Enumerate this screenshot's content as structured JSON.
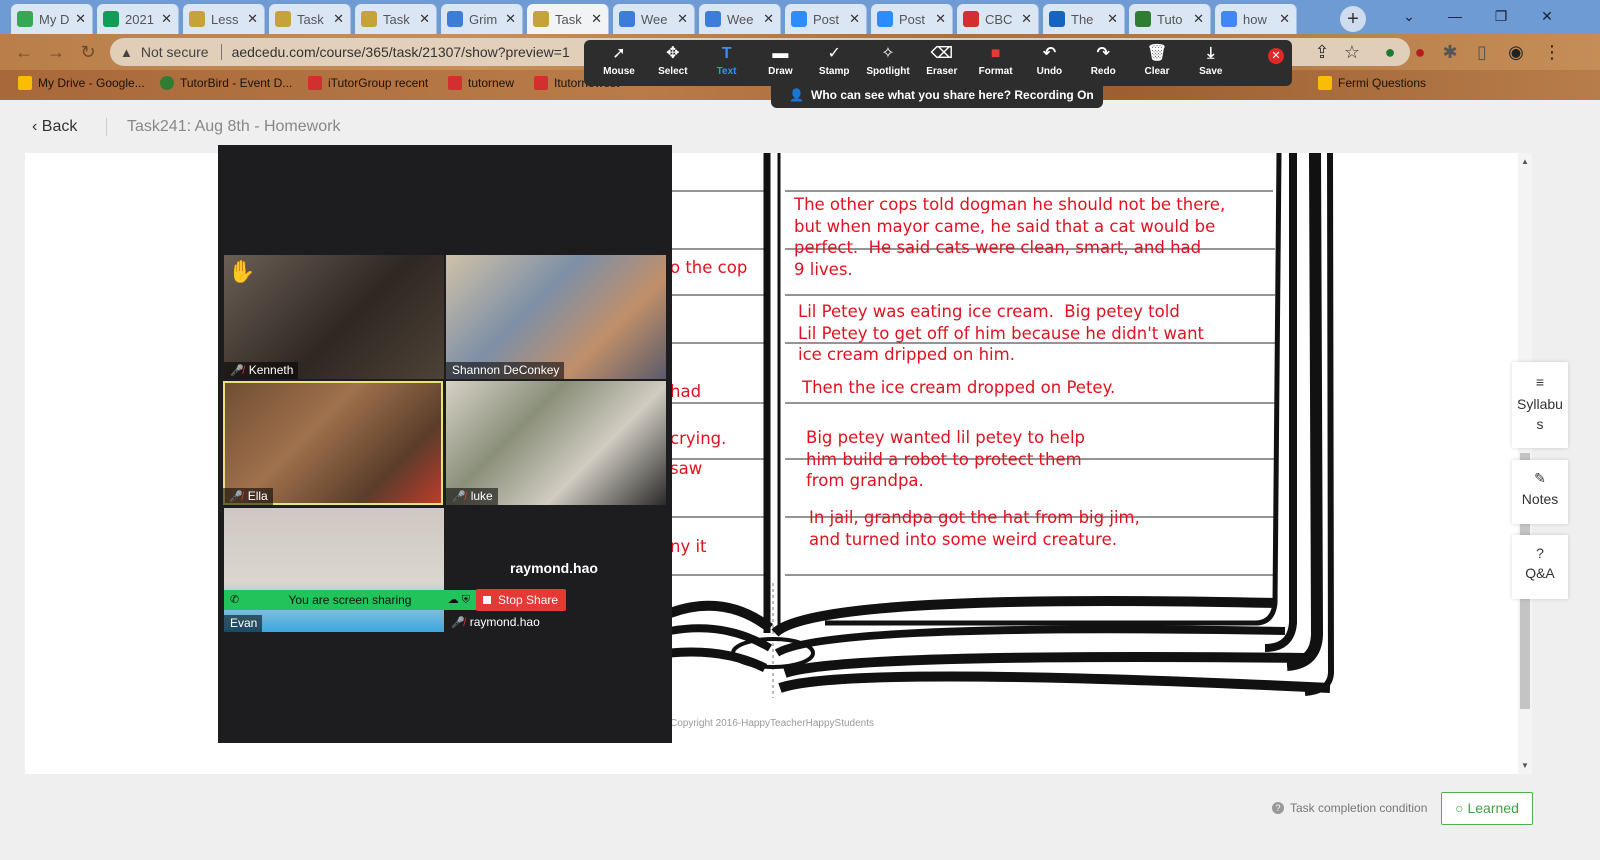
{
  "browser": {
    "tabs": [
      {
        "title": "My D",
        "color": "#34a853",
        "active": false
      },
      {
        "title": "2021",
        "color": "#0f9d58",
        "active": false
      },
      {
        "title": "Less",
        "color": "#c5a23a",
        "active": false
      },
      {
        "title": "Task",
        "color": "#c5a23a",
        "active": false
      },
      {
        "title": "Task",
        "color": "#c5a23a",
        "active": false
      },
      {
        "title": "Grim",
        "color": "#3b7dd8",
        "active": false
      },
      {
        "title": "Task",
        "color": "#c5a23a",
        "active": true
      },
      {
        "title": "Wee",
        "color": "#3b7dd8",
        "active": false
      },
      {
        "title": "Wee",
        "color": "#3b7dd8",
        "active": false
      },
      {
        "title": "Post",
        "color": "#2d8cff",
        "active": false
      },
      {
        "title": "Post",
        "color": "#2d8cff",
        "active": false
      },
      {
        "title": "CBC",
        "color": "#d32f2f",
        "active": false
      },
      {
        "title": "The",
        "color": "#1565c0",
        "active": false
      },
      {
        "title": "Tuto",
        "color": "#2e7d32",
        "active": false
      },
      {
        "title": "how",
        "color": "#4285f4",
        "active": false
      }
    ],
    "newtab_label": "+",
    "not_secure": "Not secure",
    "url": "aedcedu.com/course/365/task/21307/show?preview=1",
    "bookmarks": [
      {
        "label": "My Drive - Google...",
        "color": "#fbbc04"
      },
      {
        "label": "TutorBird - Event D...",
        "color": "#2e7d32"
      },
      {
        "label": "iTutorGroup recent",
        "color": "#d32f2f"
      },
      {
        "label": "tutornew",
        "color": "#d32f2f"
      },
      {
        "label": "Itutornewest",
        "color": "#d32f2f"
      },
      {
        "label": "Fermi Questions",
        "color": "#fbbc04"
      }
    ]
  },
  "zoom_toolbar": {
    "tools": [
      {
        "icon": "➚",
        "label": "Mouse"
      },
      {
        "icon": "✥",
        "label": "Select"
      },
      {
        "icon": "T",
        "label": "Text",
        "highlight": true
      },
      {
        "icon": "▬",
        "label": "Draw"
      },
      {
        "icon": "✓",
        "label": "Stamp"
      },
      {
        "icon": "✧",
        "label": "Spotlight"
      },
      {
        "icon": "⌫",
        "label": "Eraser"
      },
      {
        "icon": "■",
        "label": "Format"
      },
      {
        "icon": "↶",
        "label": "Undo"
      },
      {
        "icon": "↷",
        "label": "Redo"
      },
      {
        "icon": "🗑",
        "label": "Clear"
      },
      {
        "icon": "⤓",
        "label": "Save"
      }
    ],
    "banner": "Who can see what you share here? Recording On"
  },
  "page": {
    "back_label": "Back",
    "breadcrumb": "Task241:  Aug 8th - Homework",
    "copyright": "Copyright 2016-HappyTeacherHappyStudents",
    "left_fragments": [
      "o the cop",
      "had",
      "crying.",
      "saw",
      "ny it"
    ],
    "notes": [
      "The other cops told dogman he should not be there,\nbut when mayor came, he said that a cat would be\nperfect.  He said cats were clean, smart, and had\n9 lives.",
      "Lil Petey was eating ice cream.  Big petey told\nLil Petey to get off of him because he didn't want\nice cream dripped on him.",
      "Then the ice cream dropped on Petey.",
      "Big petey wanted lil petey to help\nhim build a robot to protect them\nfrom grandpa.",
      "In jail, grandpa got the hat from big jim,\nand turned into some weird creature."
    ],
    "side_tabs": [
      {
        "icon": "≡",
        "label": "Syllabu\ns"
      },
      {
        "icon": "✎",
        "label": "Notes"
      },
      {
        "icon": "?",
        "label": "Q&A"
      }
    ],
    "completion_label": "Task completion condition",
    "learned_label": "○ Learned"
  },
  "gallery": {
    "participants": [
      {
        "name": "Kenneth",
        "bg": "#4a4038"
      },
      {
        "name": "Shannon DeConkey",
        "bg": "#9c8f7e"
      },
      {
        "name": "Ella",
        "bg": "#7a5a40"
      },
      {
        "name": "luke",
        "bg": "#b7b1a4"
      },
      {
        "name": "Evan",
        "bg": "#c9c2bb"
      }
    ],
    "share_text": "You are screen sharing",
    "stop_share": "Stop Share",
    "raymond_big": "raymond.hao",
    "raymond_name": "raymond.hao"
  }
}
